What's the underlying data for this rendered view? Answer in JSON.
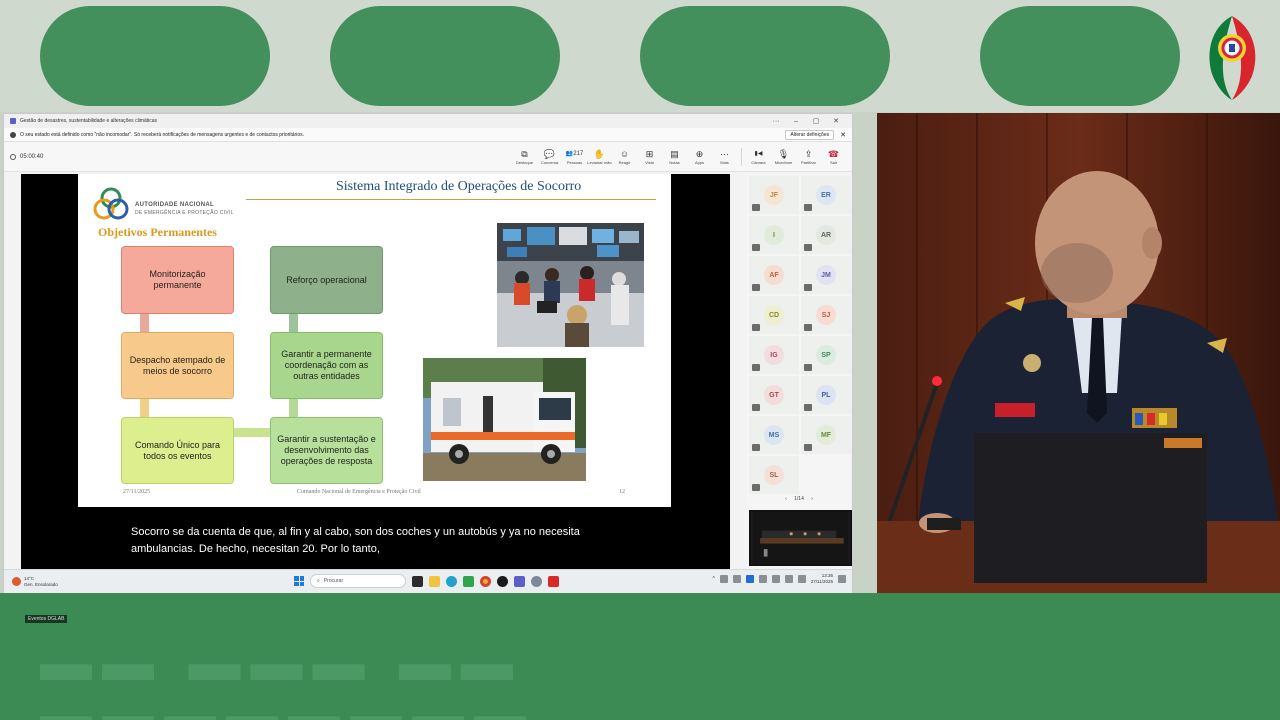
{
  "window": {
    "title": "Gestão de desastres, sustentabilidade e alterações climáticas",
    "controls": [
      "···",
      "–",
      "▢",
      "✕"
    ]
  },
  "notice": {
    "text": "O seu estado está definido como \"não incomodar\". Só receberá notificações de mensagens urgentes e de contactos prioritários.",
    "button": "Alterar definições",
    "close": "✕"
  },
  "meeting": {
    "timer": "05:00:40",
    "people_count": "217",
    "tools": [
      {
        "icon": "⧉",
        "label": "Desfoque"
      },
      {
        "icon": "💬",
        "label": "Conversa"
      },
      {
        "icon": "👥",
        "label": "Pessoas"
      },
      {
        "icon": "✋",
        "label": "Levantar mão"
      },
      {
        "icon": "☺",
        "label": "Reagir"
      },
      {
        "icon": "⊞",
        "label": "Vista"
      },
      {
        "icon": "▤",
        "label": "Notas"
      },
      {
        "icon": "⊕",
        "label": "Apps"
      },
      {
        "icon": "···",
        "label": "Mais"
      }
    ],
    "media": [
      {
        "icon": "▮◀",
        "label": "Câmara"
      },
      {
        "icon": "🎙",
        "label": "Microfone"
      },
      {
        "icon": "⇪",
        "label": "Partilhar"
      },
      {
        "icon": "☎",
        "label": "Sair"
      }
    ]
  },
  "slide": {
    "org_line1": "AUTORIDADE NACIONAL",
    "org_line2": "DE EMERGÊNCIA E PROTEÇÃO CIVIL",
    "title": "Sistema Integrado de Operações de Socorro",
    "subtitle": "Objetivos Permanentes",
    "boxes": {
      "monitorizacao": "Monitorização permanente",
      "reforco": "Reforço operacional",
      "despacho": "Despacho atempado de meios de socorro",
      "coordenacao": "Garantir a permanente coordenação com as outras entidades",
      "comando": "Comando Único para todos os eventos",
      "sustentacao": "Garantir a sustentação e desenvolvimento das operações de resposta"
    },
    "footer_date": "27/11/2025",
    "footer_center": "Comando Nacional de Emergência e Proteção Civil",
    "footer_page": "12"
  },
  "caption": {
    "line1": "Socorro se da cuenta de que, al fin y al cabo, son dos coches y un autobús y ya no necesita",
    "line2": "ambulancias. De hecho, necesitan 20. Por lo tanto,"
  },
  "stage_label": "Eventos DGLAB",
  "participants": [
    {
      "initials": "JF",
      "color": "#c0853d",
      "bg": "#f4e6d3"
    },
    {
      "initials": "ER",
      "color": "#4c6fa8",
      "bg": "#dde6f3"
    },
    {
      "initials": "I",
      "color": "#5a8a4a",
      "bg": "#e0ecd9"
    },
    {
      "initials": "AR",
      "color": "#5a6a5a",
      "bg": "#e4e8e0"
    },
    {
      "initials": "AF",
      "color": "#c0603d",
      "bg": "#f6ddd2"
    },
    {
      "initials": "JM",
      "color": "#5a5fa8",
      "bg": "#e2e2f3"
    },
    {
      "initials": "CD",
      "color": "#8a8a2a",
      "bg": "#eeeed0"
    },
    {
      "initials": "SJ",
      "color": "#c05a3d",
      "bg": "#f6dcd2"
    },
    {
      "initials": "IG",
      "color": "#a8485a",
      "bg": "#f3dce0"
    },
    {
      "initials": "SP",
      "color": "#3f8a5a",
      "bg": "#d9ecdf"
    },
    {
      "initials": "GT",
      "color": "#a8484a",
      "bg": "#f3dcdc"
    },
    {
      "initials": "PL",
      "color": "#3f5fa8",
      "bg": "#dce3f3"
    },
    {
      "initials": "MS",
      "color": "#3f6fa8",
      "bg": "#dce6f3"
    },
    {
      "initials": "MF",
      "color": "#6a8a3f",
      "bg": "#e3ecd8"
    },
    {
      "initials": "SL",
      "color": "#a8603f",
      "bg": "#f3e0d6"
    }
  ],
  "pager": {
    "prev": "‹",
    "text": "1/14",
    "next": "›"
  },
  "taskbar": {
    "weather_temp": "14°C",
    "weather_desc": "Gen. Ensolarado",
    "search_placeholder": "Procurar",
    "time": "13:36",
    "date": "27/11/2025"
  }
}
